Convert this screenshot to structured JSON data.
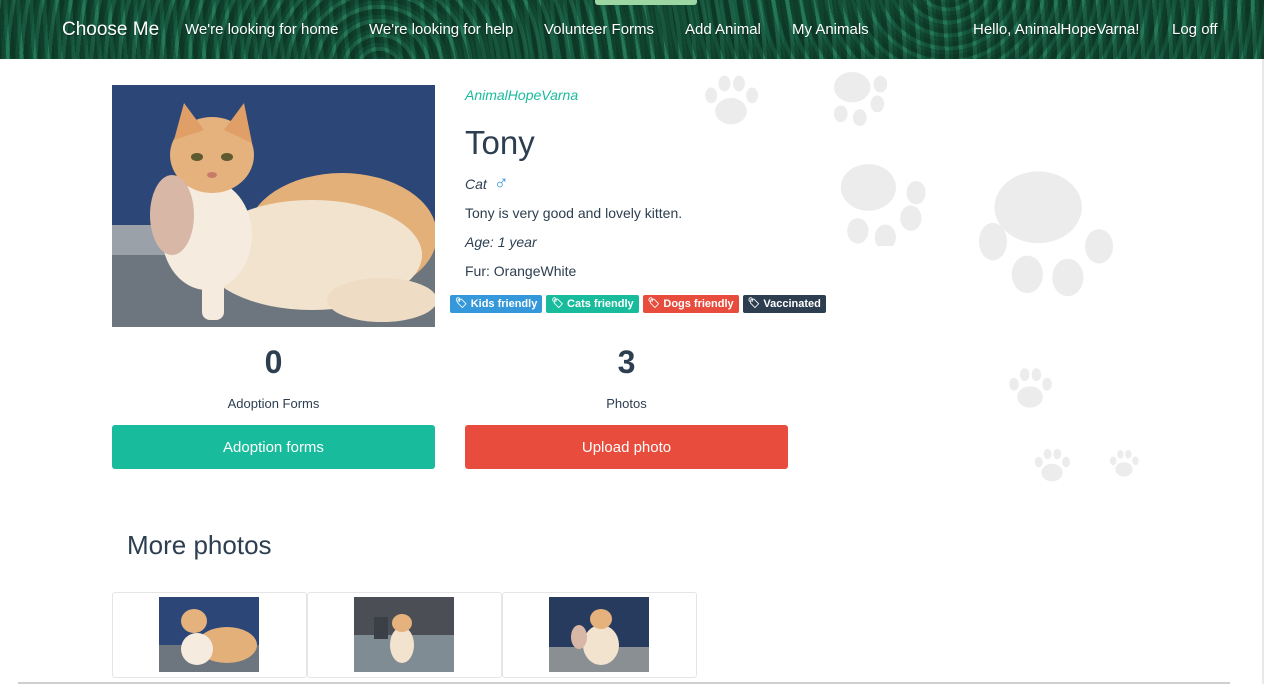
{
  "nav": {
    "brand": "Choose Me",
    "links": [
      "We're looking for home",
      "We're looking for help",
      "Volunteer Forms",
      "Add Animal",
      "My Animals"
    ],
    "greeting": "Hello, AnimalHopeVarna!",
    "logoff": "Log off"
  },
  "animal": {
    "owner": "AnimalHopeVarna",
    "name": "Tony",
    "species": "Cat",
    "gender_icon": "male-icon",
    "gender_symbol": "♂",
    "description": "Tony is very good and lovely kitten.",
    "age": "Age: 1 year",
    "fur": "Fur: OrangeWhite",
    "tags": [
      {
        "label": "Kids friendly",
        "color": "#3498db",
        "icon": "tag-icon"
      },
      {
        "label": "Cats friendly",
        "color": "#18bc9c",
        "icon": "tag-icon"
      },
      {
        "label": "Dogs friendly",
        "color": "#e74c3c",
        "icon": "tag-icon"
      },
      {
        "label": "Vaccinated",
        "color": "#2c3e50",
        "icon": "tag-icon"
      }
    ]
  },
  "stats": {
    "adoption_forms_count": "0",
    "adoption_forms_label": "Adoption Forms",
    "photos_count": "3",
    "photos_label": "Photos"
  },
  "buttons": {
    "adoption_forms": "Adoption forms",
    "upload_photo": "Upload photo"
  },
  "more_photos": {
    "title": "More photos",
    "count": 3
  },
  "colors": {
    "accent_green": "#18bc9c",
    "accent_red": "#e74c3c",
    "primary_text": "#2c3e50",
    "info_blue": "#3498db"
  }
}
